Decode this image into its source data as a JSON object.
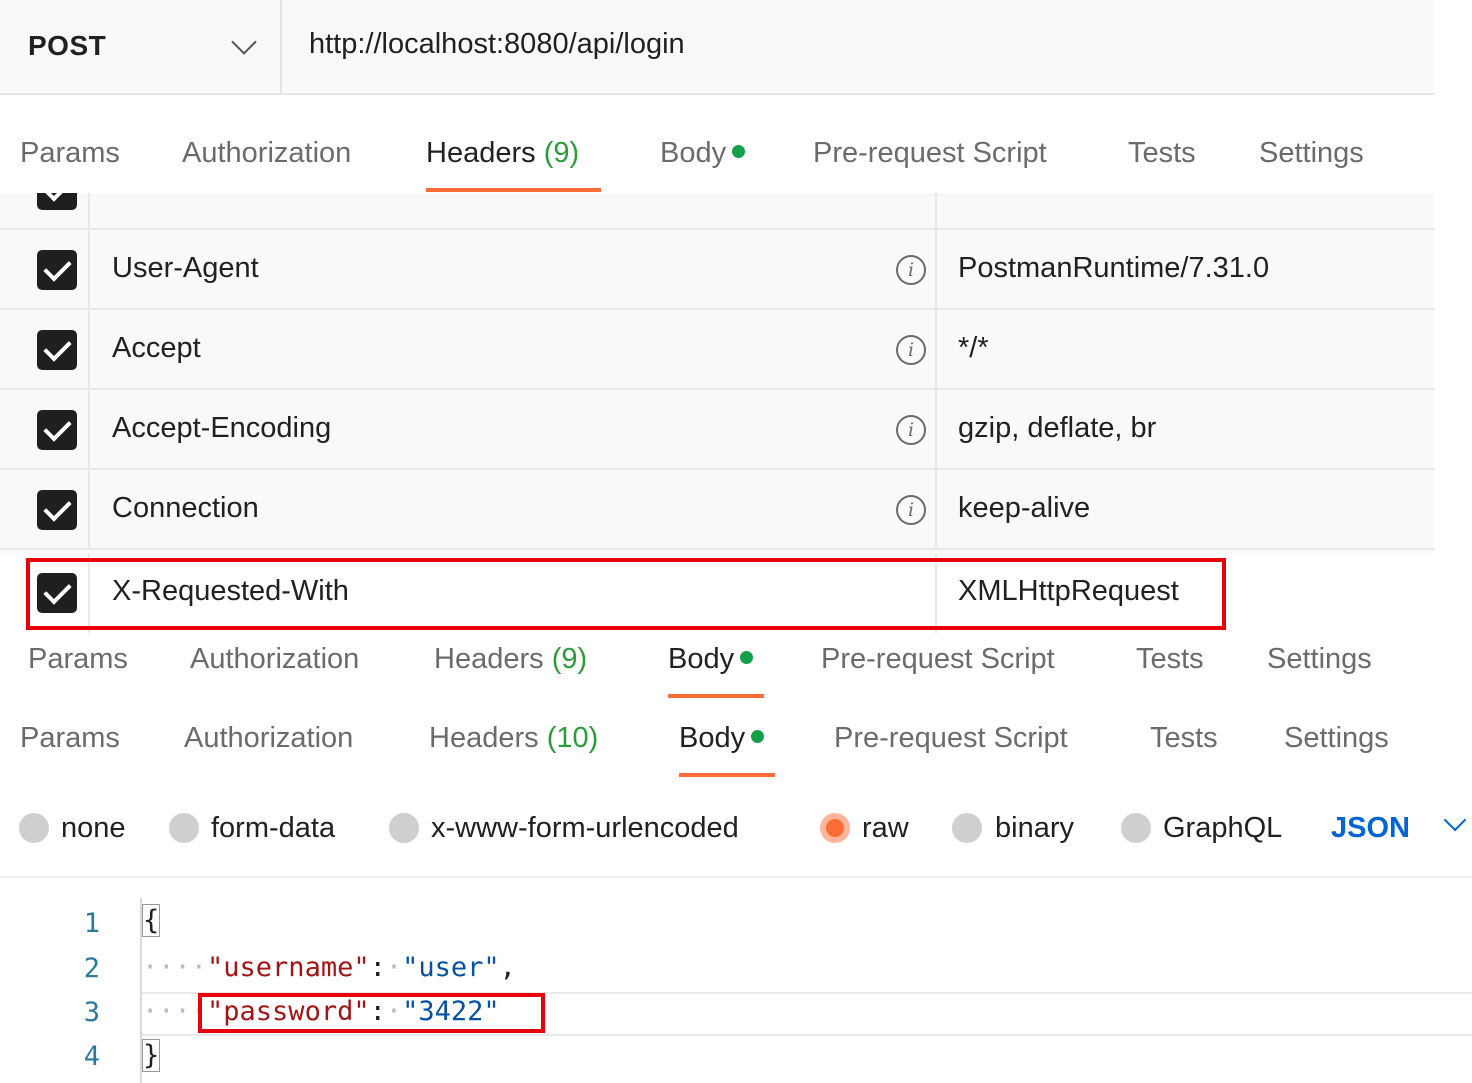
{
  "request": {
    "method": "POST",
    "url": "http://localhost:8080/api/login"
  },
  "tabs_top": {
    "params": "Params",
    "authorization": "Authorization",
    "headers": "Headers",
    "headers_count": "(9)",
    "body": "Body",
    "pre_request": "Pre-request Script",
    "tests": "Tests",
    "settings": "Settings",
    "active": "Headers"
  },
  "headers": [
    {
      "key": "User-Agent",
      "value": "PostmanRuntime/7.31.0",
      "checked": true
    },
    {
      "key": "Accept",
      "value": "*/*",
      "checked": true
    },
    {
      "key": "Accept-Encoding",
      "value": "gzip, deflate, br",
      "checked": true
    },
    {
      "key": "Connection",
      "value": "keep-alive",
      "checked": true
    }
  ],
  "highlighted_header": {
    "key": "X-Requested-With",
    "value": "XMLHttpRequest",
    "checked": true
  },
  "tabs_middle": {
    "params": "Params",
    "authorization": "Authorization",
    "headers": "Headers",
    "headers_count": "(9)",
    "body": "Body",
    "pre_request": "Pre-request Script",
    "tests": "Tests",
    "settings": "Settings",
    "active": "Body"
  },
  "tabs_bottom": {
    "params": "Params",
    "authorization": "Authorization",
    "headers": "Headers",
    "headers_count": "(10)",
    "body": "Body",
    "pre_request": "Pre-request Script",
    "tests": "Tests",
    "settings": "Settings",
    "active": "Body"
  },
  "body_types": {
    "none": "none",
    "form_data": "form-data",
    "urlencoded": "x-www-form-urlencoded",
    "raw": "raw",
    "binary": "binary",
    "graphql": "GraphQL",
    "selected": "raw",
    "format": "JSON"
  },
  "code": {
    "line_numbers": [
      "1",
      "2",
      "3",
      "4"
    ],
    "open_brace": "{",
    "close_brace": "}",
    "username_key": "\"username\"",
    "username_value": "\"user\"",
    "password_key": "\"password\"",
    "password_value": "\"3422\""
  },
  "colors": {
    "accent": "#ff6c37",
    "highlight_border": "#e8000b",
    "json_blue": "#0265d2",
    "status_dot": "#14a04a"
  }
}
